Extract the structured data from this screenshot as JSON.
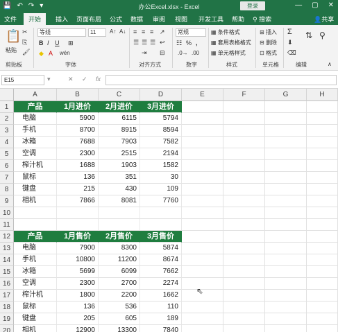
{
  "titlebar": {
    "title": "办公Excel.xlsx  -  Excel",
    "login_label": "登录",
    "qa_save": "💾",
    "qa_undo": "↶",
    "qa_redo": "↷",
    "qa_more": "▾",
    "win_min": "—",
    "win_max": "▢",
    "win_close": "✕"
  },
  "tabs": [
    "文件",
    "开始",
    "插入",
    "页面布局",
    "公式",
    "数据",
    "审阅",
    "视图",
    "开发工具",
    "帮助"
  ],
  "tab_search": "搜索",
  "tab_share": "共享",
  "ribbon": {
    "paste_label": "粘贴",
    "font_name": "等线",
    "font_size": "11",
    "number_format": "常规",
    "groups": {
      "clipboard": "剪贴板",
      "font": "字体",
      "alignment": "对齐方式",
      "number": "数字",
      "styles": "样式",
      "cells": "单元格",
      "editing": "编辑"
    },
    "styles_items": [
      "条件格式",
      "套用表格格式",
      "单元格样式"
    ],
    "cells_items": [
      "插入",
      "删除",
      "格式"
    ],
    "percent": "%",
    "comma": ","
  },
  "formula_bar": {
    "name_box": "E15",
    "fx": "fx",
    "cancel": "✕",
    "enter": "✓",
    "value": ""
  },
  "columns": [
    "A",
    "B",
    "C",
    "D",
    "E",
    "F",
    "G",
    "H"
  ],
  "rows": [
    {
      "num": "1",
      "type": "header",
      "cells": [
        "产品",
        "1月进价",
        "2月进价",
        "3月进价"
      ]
    },
    {
      "num": "2",
      "type": "data",
      "cells": [
        "电脑",
        "5900",
        "6115",
        "5794"
      ]
    },
    {
      "num": "3",
      "type": "data",
      "cells": [
        "手机",
        "8700",
        "8915",
        "8594"
      ]
    },
    {
      "num": "4",
      "type": "data",
      "cells": [
        "冰箱",
        "7688",
        "7903",
        "7582"
      ]
    },
    {
      "num": "5",
      "type": "data",
      "cells": [
        "空调",
        "2300",
        "2515",
        "2194"
      ]
    },
    {
      "num": "6",
      "type": "data",
      "cells": [
        "榨汁机",
        "1688",
        "1903",
        "1582"
      ]
    },
    {
      "num": "7",
      "type": "data",
      "cells": [
        "鼠标",
        "136",
        "351",
        "30"
      ]
    },
    {
      "num": "8",
      "type": "data",
      "cells": [
        "键盘",
        "215",
        "430",
        "109"
      ]
    },
    {
      "num": "9",
      "type": "data",
      "cells": [
        "相机",
        "7866",
        "8081",
        "7760"
      ]
    },
    {
      "num": "10",
      "type": "empty",
      "cells": [
        "",
        "",
        "",
        ""
      ]
    },
    {
      "num": "11",
      "type": "empty",
      "cells": [
        "",
        "",
        "",
        ""
      ]
    },
    {
      "num": "12",
      "type": "header",
      "cells": [
        "产品",
        "1月售价",
        "2月售价",
        "3月售价"
      ]
    },
    {
      "num": "13",
      "type": "data",
      "cells": [
        "电脑",
        "7900",
        "8300",
        "5874"
      ]
    },
    {
      "num": "14",
      "type": "data",
      "cells": [
        "手机",
        "10800",
        "11200",
        "8674"
      ]
    },
    {
      "num": "15",
      "type": "data",
      "cells": [
        "冰箱",
        "5699",
        "6099",
        "7662"
      ]
    },
    {
      "num": "16",
      "type": "data",
      "cells": [
        "空调",
        "2300",
        "2700",
        "2274"
      ]
    },
    {
      "num": "17",
      "type": "data",
      "cells": [
        "榨汁机",
        "1800",
        "2200",
        "1662"
      ]
    },
    {
      "num": "18",
      "type": "data",
      "cells": [
        "鼠标",
        "136",
        "536",
        "110"
      ]
    },
    {
      "num": "19",
      "type": "data",
      "cells": [
        "键盘",
        "205",
        "605",
        "189"
      ]
    },
    {
      "num": "20",
      "type": "data",
      "cells": [
        "相机",
        "12900",
        "13300",
        "7840"
      ]
    }
  ],
  "colors": {
    "excel_green": "#217346",
    "table_header_green": "#1f7d3f"
  }
}
